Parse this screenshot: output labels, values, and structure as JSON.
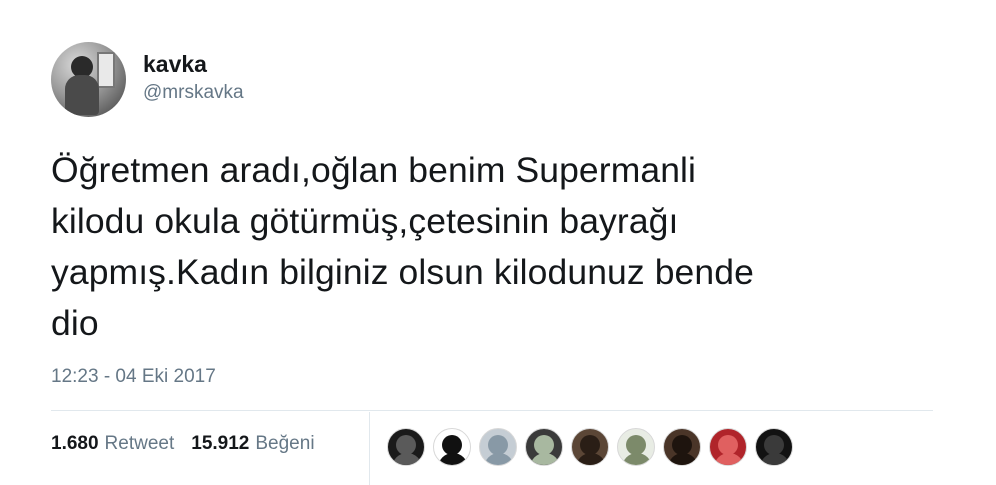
{
  "user": {
    "display_name": "kavka",
    "screen_name": "@mrskavka"
  },
  "tweet": {
    "text_lines": [
      "Öğretmen aradı,oğlan benim Supermanli",
      "kilodu okula götürmüş,çetesinin bayrağı",
      "yapmış.Kadın bilginiz olsun kilodunuz bende",
      "dio"
    ],
    "timestamp": "12:23 - 04 Eki 2017"
  },
  "stats": {
    "retweets": {
      "count": "1.680",
      "label": "Retweet"
    },
    "likes": {
      "count": "15.912",
      "label": "Beğeni"
    }
  },
  "likers": [
    {
      "name": "liker-avatar-1",
      "bg": "#1a1a1a",
      "fg": "#5a5a5a"
    },
    {
      "name": "liker-avatar-2",
      "bg": "#ffffff",
      "fg": "#111111"
    },
    {
      "name": "liker-avatar-3",
      "bg": "#c5cdd4",
      "fg": "#8899a6"
    },
    {
      "name": "liker-avatar-4",
      "bg": "#3a3a3a",
      "fg": "#a8b8a0"
    },
    {
      "name": "liker-avatar-5",
      "bg": "#5b4636",
      "fg": "#2a1e16"
    },
    {
      "name": "liker-avatar-6",
      "bg": "#e8ece4",
      "fg": "#7c8a6a"
    },
    {
      "name": "liker-avatar-7",
      "bg": "#4a3528",
      "fg": "#1e140e"
    },
    {
      "name": "liker-avatar-8",
      "bg": "#b0242a",
      "fg": "#e06060"
    },
    {
      "name": "liker-avatar-9",
      "bg": "#121212",
      "fg": "#3a3a3a"
    }
  ]
}
